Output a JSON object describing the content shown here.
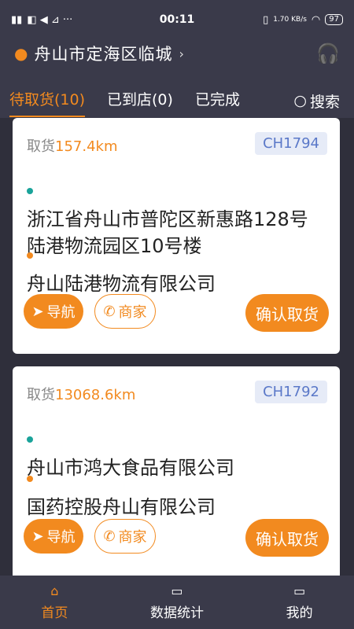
{
  "status_bar": {
    "time": "00:11",
    "left_icons": [
      "signal-icon",
      "wifi-icon",
      "notification-icon"
    ],
    "speed": "1.70 KB/s",
    "battery": "97"
  },
  "location": {
    "label": "舟山市定海区临城"
  },
  "tabs": [
    {
      "label": "待取货(10)",
      "active": true
    },
    {
      "label": "已到店(0)",
      "active": false
    },
    {
      "label": "已完成",
      "active": false
    }
  ],
  "search": {
    "label": "搜索"
  },
  "orders": [
    {
      "pickup_label": "取货",
      "distance": "157.4km",
      "code": "CH1794",
      "from_address": "浙江省舟山市普陀区新惠路128号陆港物流园区10号楼",
      "to_name": "舟山陆港物流有限公司",
      "nav_label": "导航",
      "merchant_label": "商家",
      "confirm_label": "确认取货"
    },
    {
      "pickup_label": "取货",
      "distance": "13068.6km",
      "code": "CH1792",
      "from_address": "舟山市鸿大食品有限公司",
      "to_name": "国药控股舟山有限公司",
      "nav_label": "导航",
      "merchant_label": "商家",
      "confirm_label": "确认取货"
    }
  ],
  "bottom_nav": [
    {
      "label": "首页",
      "icon": "home-icon",
      "active": true
    },
    {
      "label": "数据统计",
      "icon": "chart-icon",
      "active": false
    },
    {
      "label": "我的",
      "icon": "profile-icon",
      "active": false
    }
  ],
  "colors": {
    "accent": "#f28a1f",
    "background": "#3a3a4a",
    "badge_bg": "#e6ebf7"
  }
}
